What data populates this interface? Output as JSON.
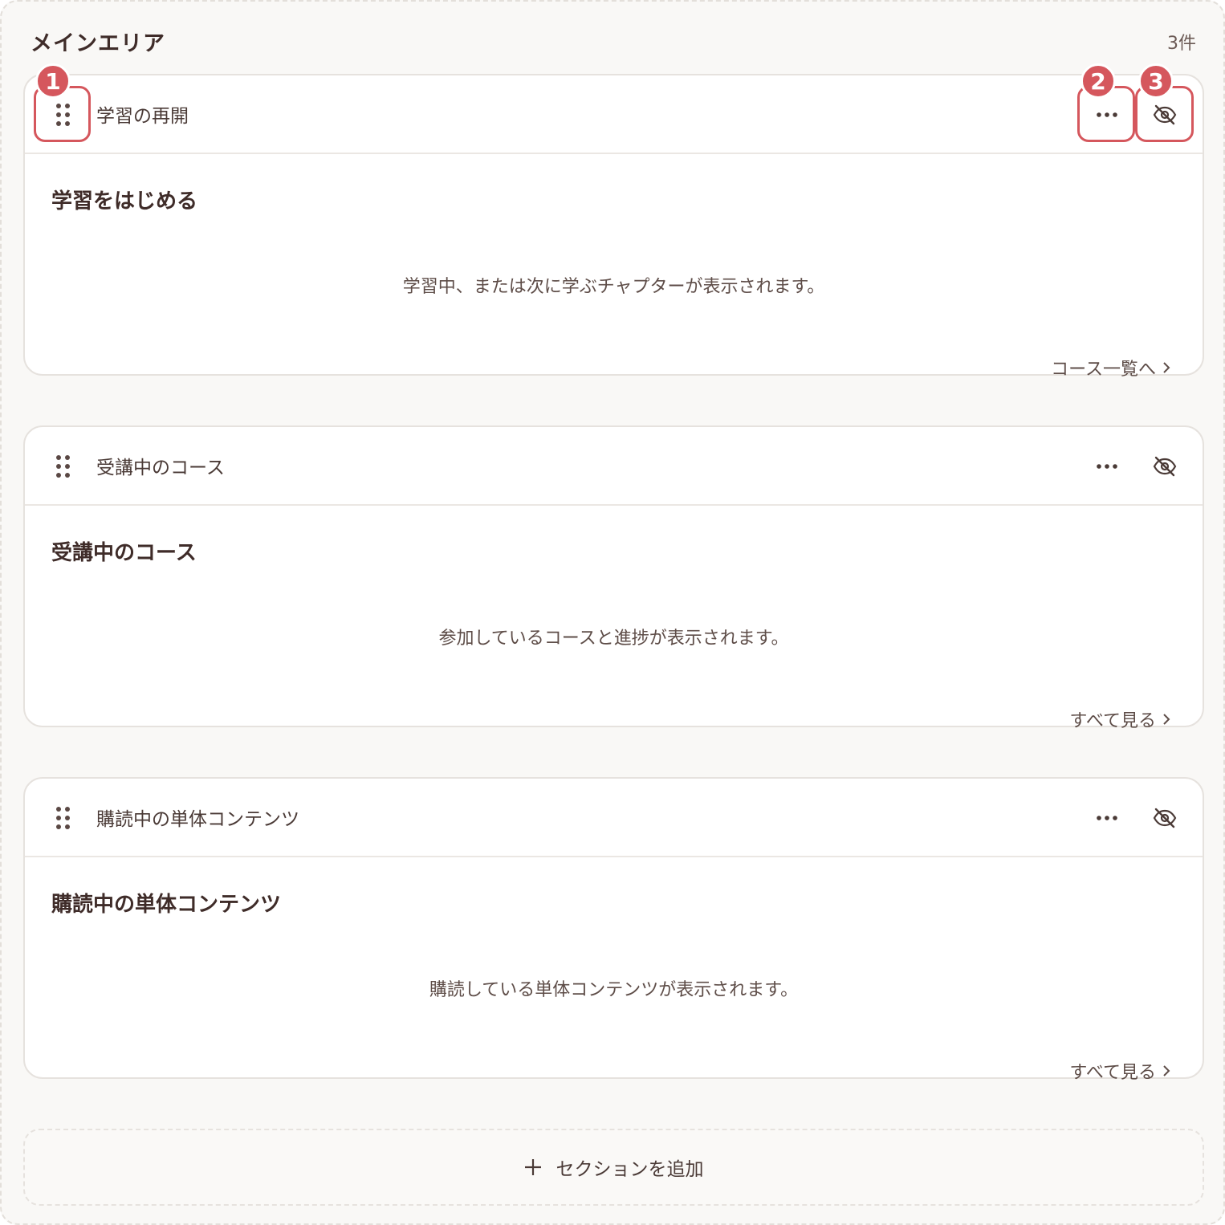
{
  "area": {
    "title": "メインエリア",
    "count": "3件"
  },
  "sections": [
    {
      "name": "学習の再開",
      "content_title": "学習をはじめる",
      "description": "学習中、または次に学ぶチャプターが表示されます。",
      "link_label": "コース一覧へ"
    },
    {
      "name": "受講中のコース",
      "content_title": "受講中のコース",
      "description": "参加しているコースと進捗が表示されます。",
      "link_label": "すべて見る"
    },
    {
      "name": "購読中の単体コンテンツ",
      "content_title": "購読中の単体コンテンツ",
      "description": "購読している単体コンテンツが表示されます。",
      "link_label": "すべて見る"
    }
  ],
  "add_section": {
    "label": "セクションを追加"
  },
  "callouts": [
    "1",
    "2",
    "3"
  ],
  "colors": {
    "accent": "#d5575d",
    "text": "#4a3a36",
    "heading": "#3f2c29",
    "background": "#f9f8f6",
    "card_border": "#e6e2de"
  },
  "icons": {
    "drag": "drag-handle-icon",
    "more": "more-horizontal-icon",
    "visibility": "eye-off-icon",
    "link": "chevron-right-icon",
    "add": "plus-icon"
  }
}
